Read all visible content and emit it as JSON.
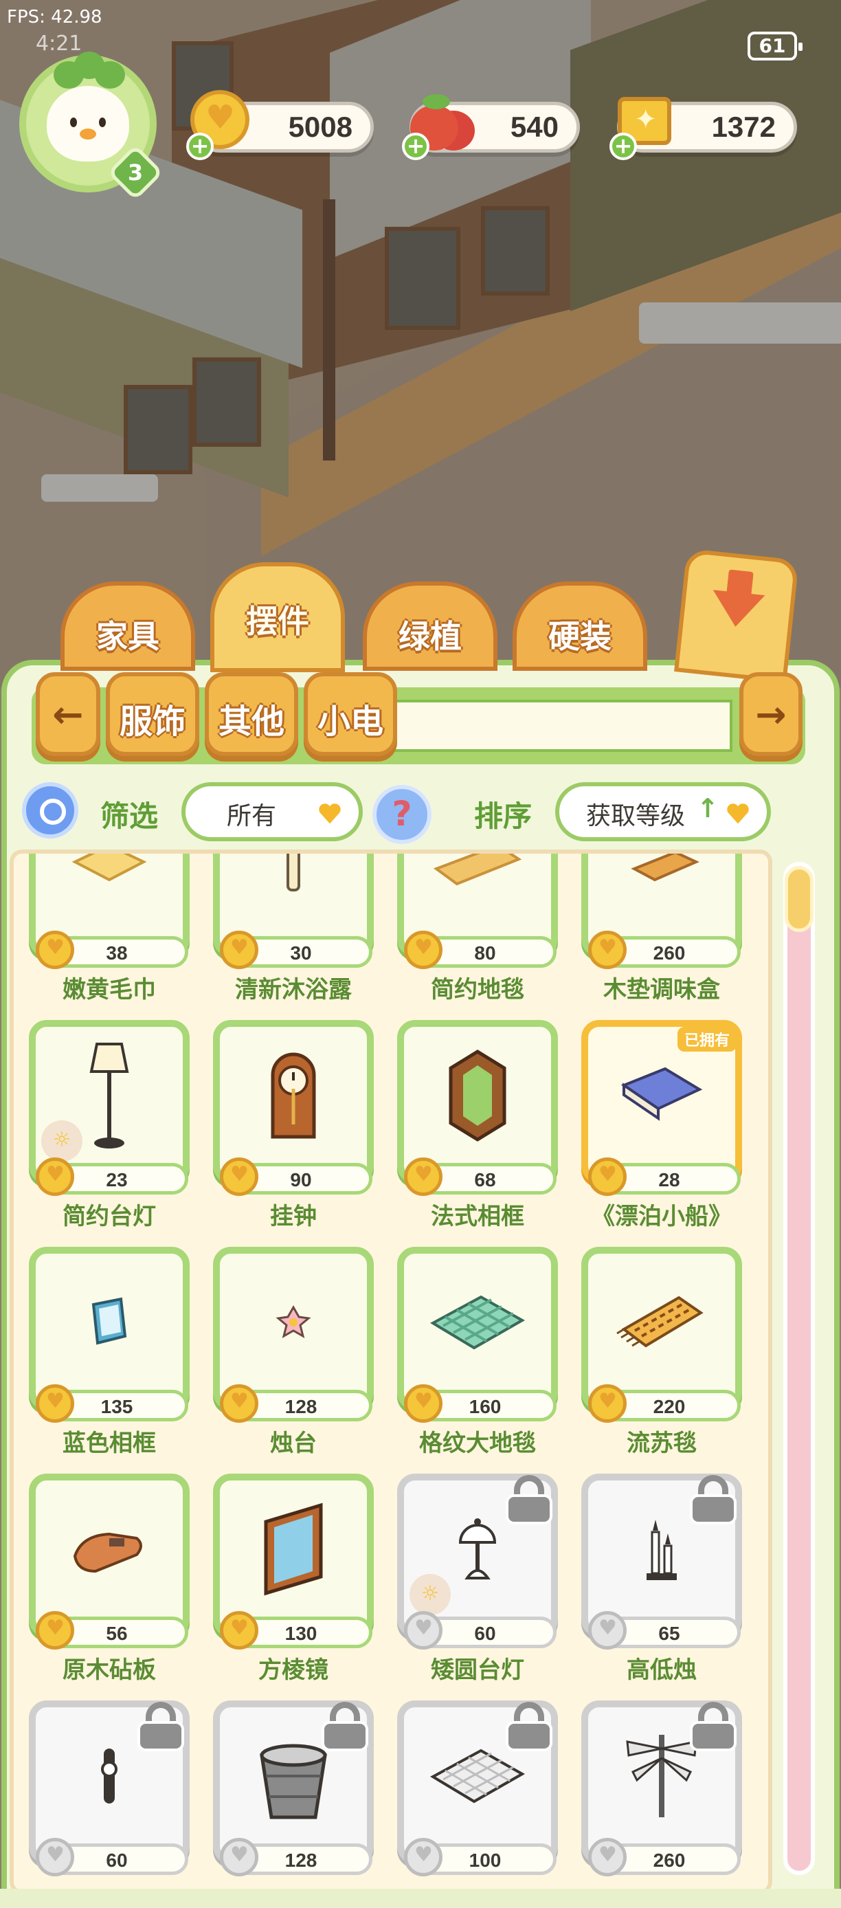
{
  "status": {
    "fps": "FPS: 42.98",
    "time": "4:21",
    "battery": "61"
  },
  "player": {
    "level": "3"
  },
  "currencies": [
    {
      "name": "coins",
      "icon": "heart-coin-icon",
      "value": "5008"
    },
    {
      "name": "tomatoes",
      "icon": "tomato-icon",
      "value": "540"
    },
    {
      "name": "gift-tickets",
      "icon": "gift-ticket-icon",
      "value": "1372"
    }
  ],
  "tabs": [
    {
      "label": "家具",
      "active": false
    },
    {
      "label": "摆件",
      "active": true
    },
    {
      "label": "绿植",
      "active": false
    },
    {
      "label": "硬装",
      "active": false
    }
  ],
  "subnav": {
    "prev": "←",
    "next": "→",
    "items": [
      "服饰",
      "其他",
      "小电"
    ]
  },
  "filter": {
    "label": "筛选",
    "value": "所有"
  },
  "sort": {
    "label": "排序",
    "value": "获取等级"
  },
  "items": [
    {
      "name": "嫩黄毛巾",
      "price": "38",
      "state": "normal",
      "icon": "towel-icon"
    },
    {
      "name": "清新沐浴露",
      "price": "30",
      "state": "normal",
      "icon": "bottle-icon"
    },
    {
      "name": "简约地毯",
      "price": "80",
      "state": "normal",
      "icon": "rug-icon"
    },
    {
      "name": "木垫调味盒",
      "price": "260",
      "state": "normal",
      "icon": "spice-box-icon"
    },
    {
      "name": "简约台灯",
      "price": "23",
      "state": "normal",
      "icon": "floor-lamp-icon",
      "hint": true
    },
    {
      "name": "挂钟",
      "price": "90",
      "state": "normal",
      "icon": "wall-clock-icon"
    },
    {
      "name": "法式相框",
      "price": "68",
      "state": "normal",
      "icon": "frame-icon"
    },
    {
      "name": "《漂泊小船》",
      "price": "28",
      "state": "owned",
      "icon": "book-icon",
      "badge": "已拥有"
    },
    {
      "name": "蓝色相框",
      "price": "135",
      "state": "normal",
      "icon": "blue-frame-icon"
    },
    {
      "name": "烛台",
      "price": "128",
      "state": "normal",
      "icon": "candle-icon"
    },
    {
      "name": "格纹大地毯",
      "price": "160",
      "state": "normal",
      "icon": "check-rug-icon"
    },
    {
      "name": "流苏毯",
      "price": "220",
      "state": "normal",
      "icon": "tassel-rug-icon"
    },
    {
      "name": "原木砧板",
      "price": "56",
      "state": "normal",
      "icon": "cutting-board-icon"
    },
    {
      "name": "方棱镜",
      "price": "130",
      "state": "normal",
      "icon": "mirror-icon"
    },
    {
      "name": "矮圆台灯",
      "price": "60",
      "state": "locked",
      "icon": "table-lamp-icon",
      "hint": true
    },
    {
      "name": "高低烛",
      "price": "65",
      "state": "locked",
      "icon": "candles-icon"
    },
    {
      "name": "",
      "price": "60",
      "state": "locked",
      "icon": "hook-icon"
    },
    {
      "name": "",
      "price": "128",
      "state": "locked",
      "icon": "basket-icon"
    },
    {
      "name": "",
      "price": "100",
      "state": "locked",
      "icon": "mat-icon"
    },
    {
      "name": "",
      "price": "260",
      "state": "locked",
      "icon": "dragonfly-icon"
    }
  ]
}
